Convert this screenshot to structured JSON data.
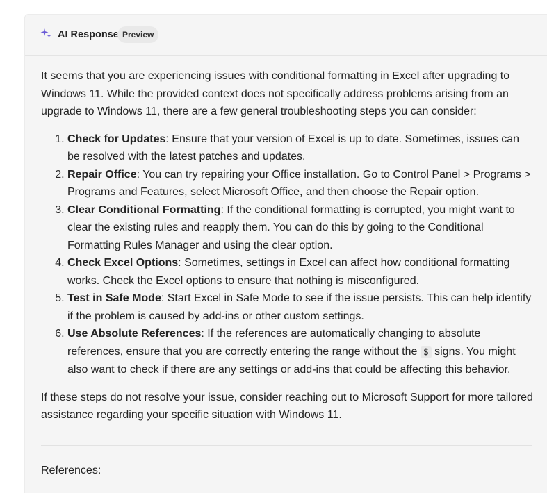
{
  "header": {
    "icon": "sparkle-icon",
    "icon_color": "#6b5bd6",
    "title": "AI Response",
    "badge": "Preview"
  },
  "response": {
    "intro": "It seems that you are experiencing issues with conditional formatting in Excel after upgrading to Windows 11. While the provided context does not specifically address problems arising from an upgrade to Windows 11, there are a few general troubleshooting steps you can consider:",
    "steps": [
      {
        "title": "Check for Updates",
        "text": ": Ensure that your version of Excel is up to date. Sometimes, issues can be resolved with the latest patches and updates."
      },
      {
        "title": "Repair Office",
        "text": ": You can try repairing your Office installation. Go to Control Panel > Programs > Programs and Features, select Microsoft Office, and then choose the Repair option."
      },
      {
        "title": "Clear Conditional Formatting",
        "text": ": If the conditional formatting is corrupted, you might want to clear the existing rules and reapply them. You can do this by going to the Conditional Formatting Rules Manager and using the clear option."
      },
      {
        "title": "Check Excel Options",
        "text": ": Sometimes, settings in Excel can affect how conditional formatting works. Check the Excel options to ensure that nothing is misconfigured."
      },
      {
        "title": "Test in Safe Mode",
        "text": ": Start Excel in Safe Mode to see if the issue persists. This can help identify if the problem is caused by add-ins or other custom settings."
      },
      {
        "title": "Use Absolute References",
        "text_before_code": ": If the references are automatically changing to absolute references, ensure that you are correctly entering the range without the ",
        "code": "$",
        "text_after_code": " signs. You might also want to check if there are any settings or add-ins that could be affecting this behavior."
      }
    ],
    "outro": "If these steps do not resolve your issue, consider reaching out to Microsoft Support for more tailored assistance regarding your specific situation with Windows 11."
  },
  "references": {
    "label": "References:"
  }
}
